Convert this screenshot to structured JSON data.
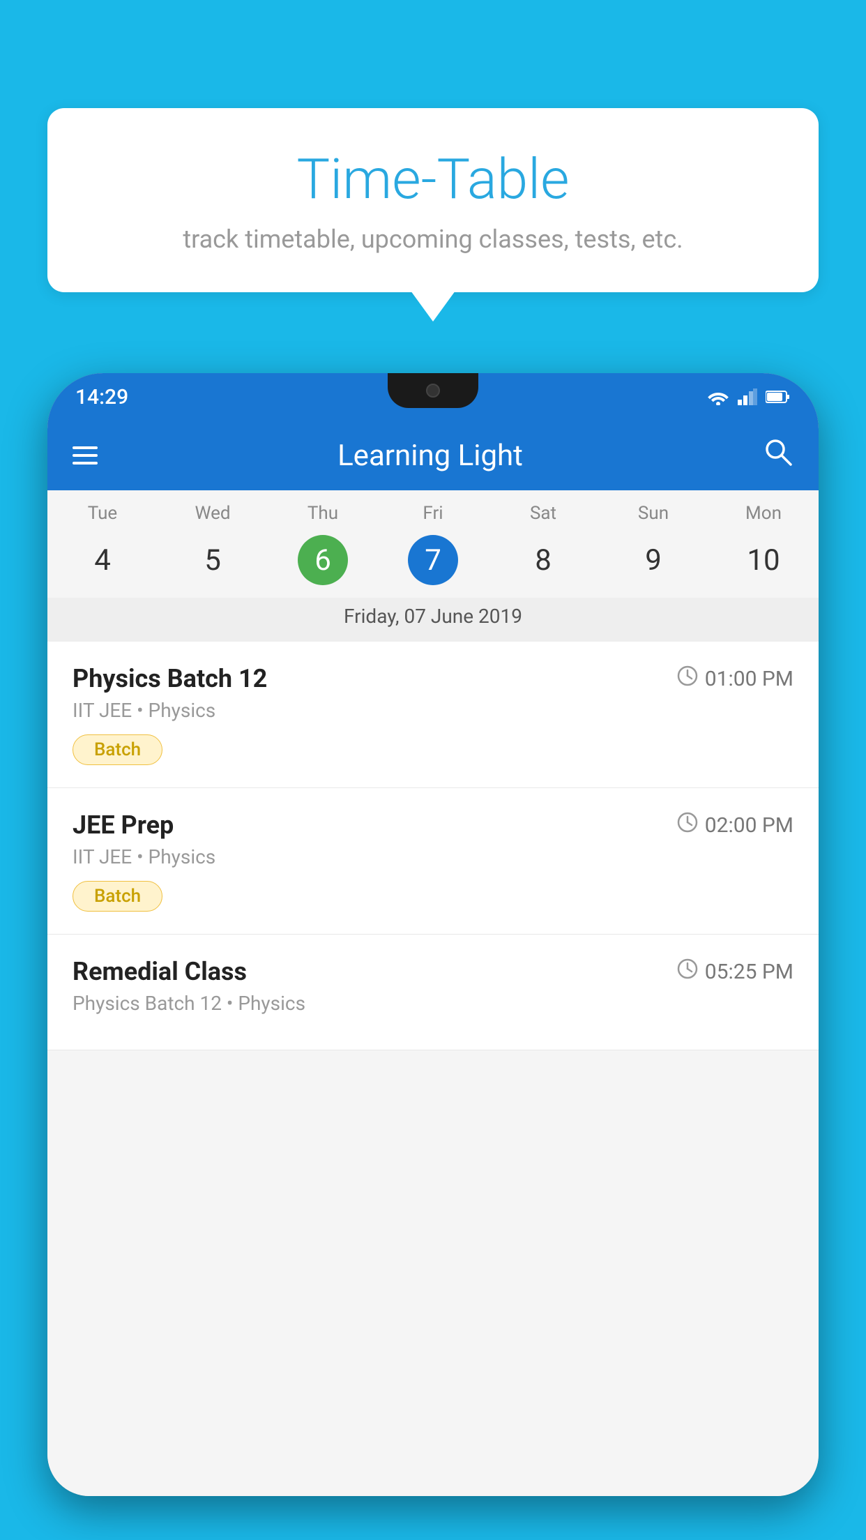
{
  "background_color": "#1ab8e8",
  "speech_bubble": {
    "title": "Time-Table",
    "subtitle": "track timetable, upcoming classes, tests, etc."
  },
  "phone": {
    "status_bar": {
      "time": "14:29"
    },
    "app_header": {
      "title": "Learning Light"
    },
    "calendar": {
      "days": [
        {
          "label": "Tue",
          "number": "4"
        },
        {
          "label": "Wed",
          "number": "5"
        },
        {
          "label": "Thu",
          "number": "6",
          "state": "today"
        },
        {
          "label": "Fri",
          "number": "7",
          "state": "selected"
        },
        {
          "label": "Sat",
          "number": "8"
        },
        {
          "label": "Sun",
          "number": "9"
        },
        {
          "label": "Mon",
          "number": "10"
        }
      ],
      "selected_date_label": "Friday, 07 June 2019"
    },
    "schedule": [
      {
        "title": "Physics Batch 12",
        "time": "01:00 PM",
        "subtitle": "IIT JEE • Physics",
        "badge": "Batch"
      },
      {
        "title": "JEE Prep",
        "time": "02:00 PM",
        "subtitle": "IIT JEE • Physics",
        "badge": "Batch"
      },
      {
        "title": "Remedial Class",
        "time": "05:25 PM",
        "subtitle": "Physics Batch 12 • Physics",
        "badge": null
      }
    ]
  }
}
